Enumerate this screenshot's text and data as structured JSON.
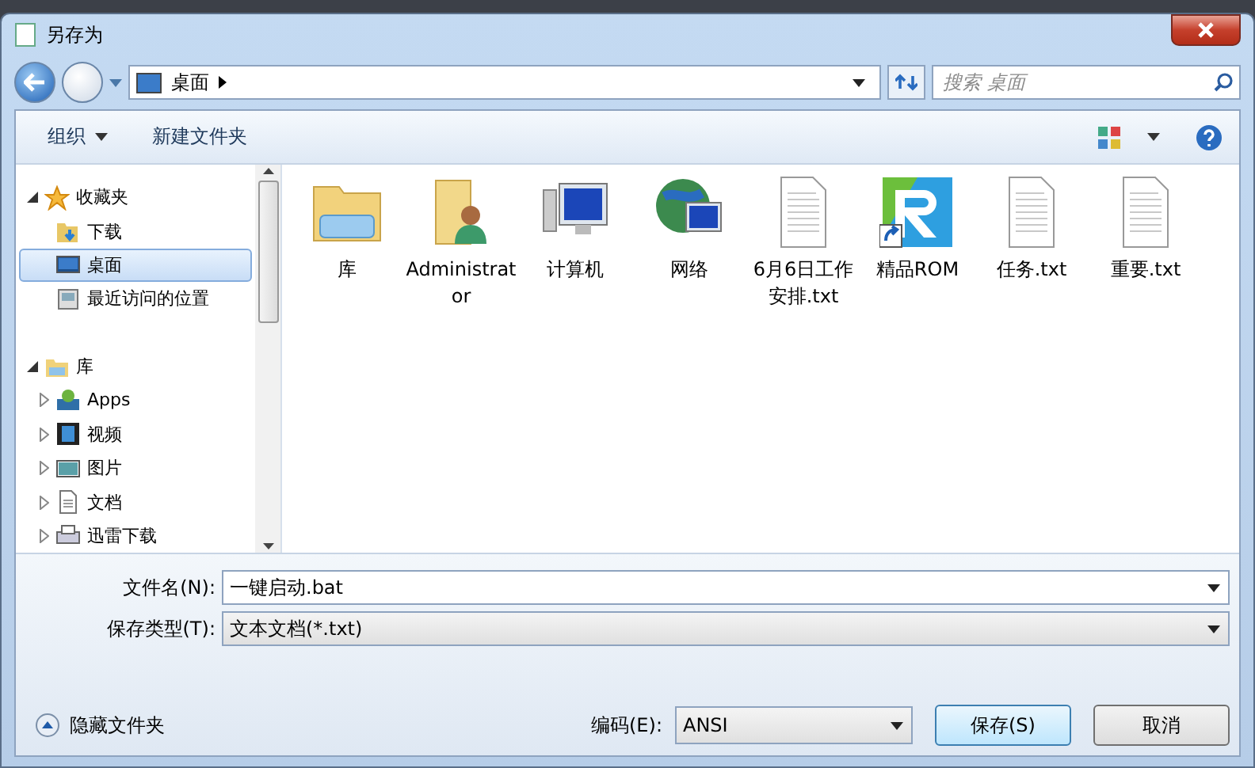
{
  "window": {
    "title": "另存为"
  },
  "address": {
    "path": "桌面",
    "search_placeholder": "搜索 桌面"
  },
  "toolbar": {
    "organize": "组织",
    "new_folder": "新建文件夹"
  },
  "nav": [
    {
      "label": "收藏夹",
      "kind": "star",
      "expanded": true,
      "selected": false,
      "children": [
        {
          "label": "下载",
          "kind": "download",
          "selected": false
        },
        {
          "label": "桌面",
          "kind": "desktop",
          "selected": true
        },
        {
          "label": "最近访问的位置",
          "kind": "recent",
          "selected": false
        }
      ]
    },
    {
      "label": "库",
      "kind": "library",
      "expanded": true,
      "selected": false,
      "children": [
        {
          "label": "Apps",
          "kind": "apps",
          "selected": false,
          "expanded": false
        },
        {
          "label": "视频",
          "kind": "video",
          "selected": false,
          "expanded": false
        },
        {
          "label": "图片",
          "kind": "picture",
          "selected": false,
          "expanded": false
        },
        {
          "label": "文档",
          "kind": "document",
          "selected": false,
          "expanded": false
        },
        {
          "label": "迅雷下载",
          "kind": "printer",
          "selected": false,
          "expanded": false
        }
      ]
    }
  ],
  "files": [
    {
      "name": "库",
      "kind": "library"
    },
    {
      "name": "Administrator",
      "kind": "user"
    },
    {
      "name": "计算机",
      "kind": "computer"
    },
    {
      "name": "网络",
      "kind": "network"
    },
    {
      "name": "6月6日工作安排.txt",
      "kind": "text"
    },
    {
      "name": "精品ROM",
      "kind": "shortcut"
    },
    {
      "name": "任务.txt",
      "kind": "text"
    },
    {
      "name": "重要.txt",
      "kind": "text"
    }
  ],
  "filename": {
    "label": "文件名(N):",
    "value": "一键启动.bat"
  },
  "filetype": {
    "label": "保存类型(T):",
    "value": "文本文档(*.txt)"
  },
  "hide_folders": "隐藏文件夹",
  "encoding": {
    "label": "编码(E):",
    "value": "ANSI"
  },
  "buttons": [
    "保存(S)",
    "取消"
  ]
}
